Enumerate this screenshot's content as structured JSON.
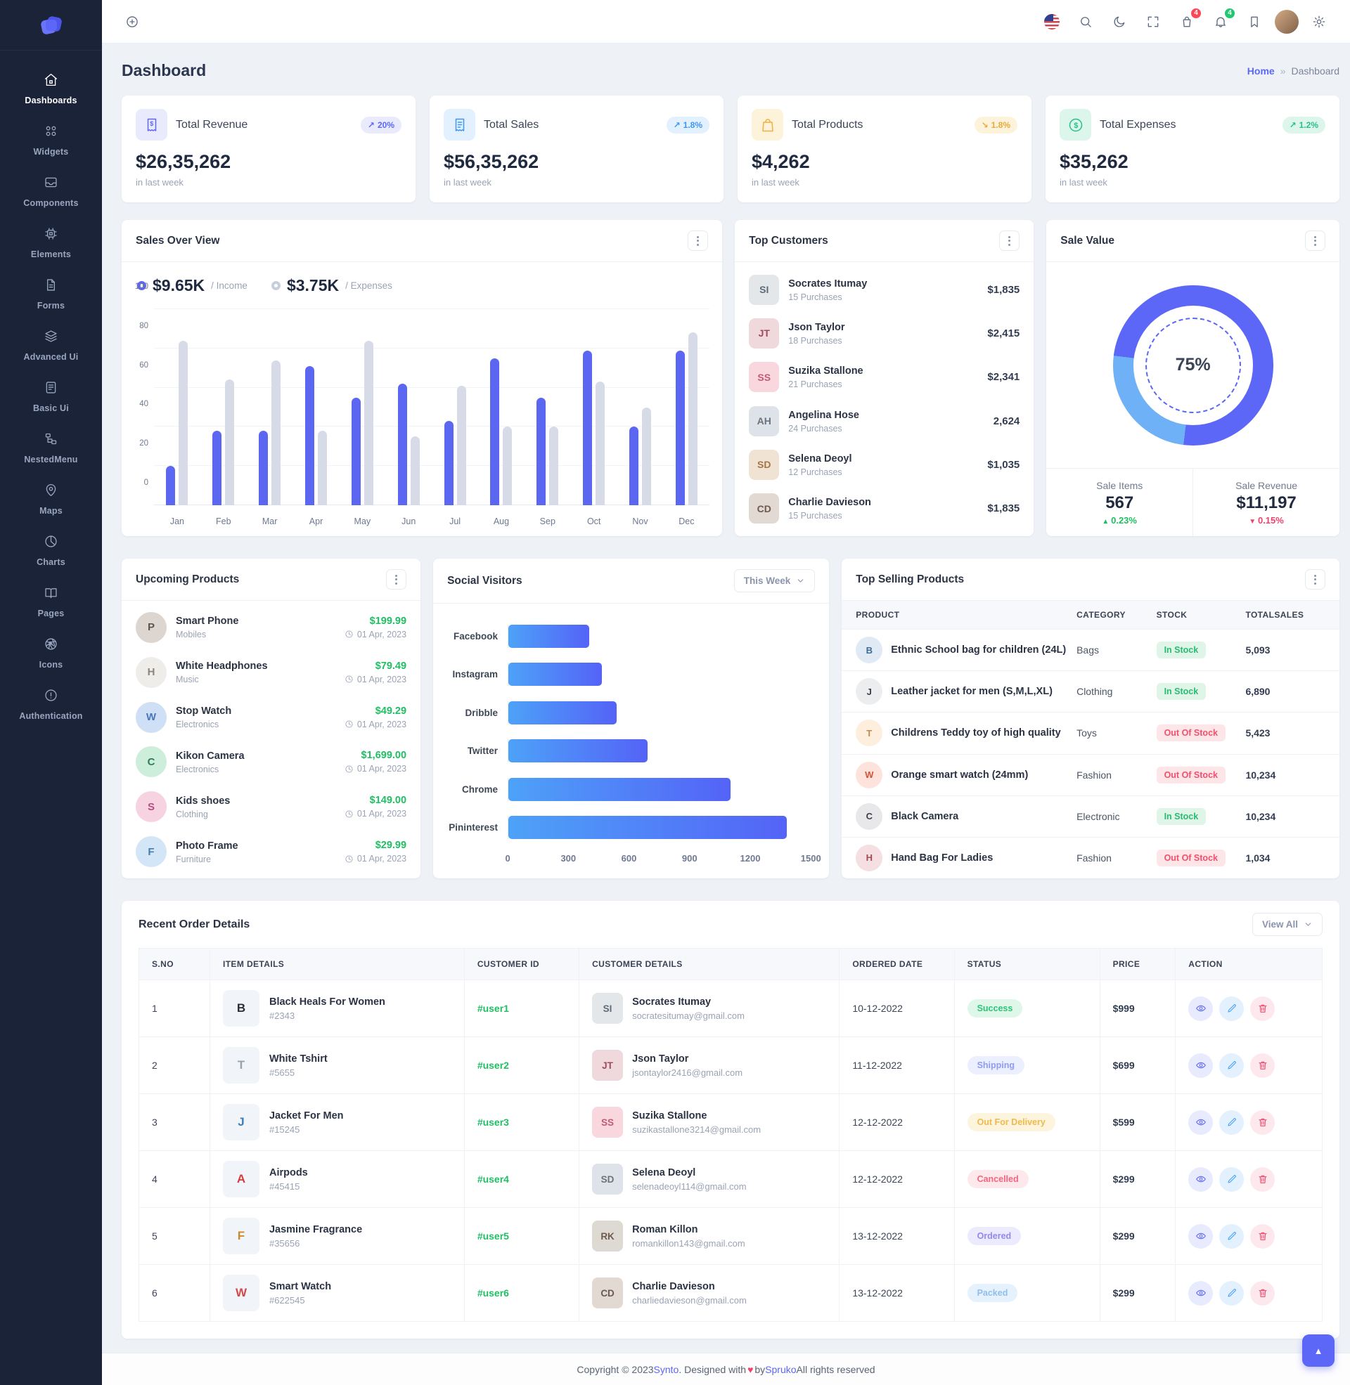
{
  "app": {
    "name": "Synto"
  },
  "header": {
    "cart_badge": "4",
    "notification_badge": "4",
    "icons": [
      "plus-circle-icon",
      "us-flag-icon",
      "search-icon",
      "moon-icon",
      "fullscreen-icon",
      "basket-icon",
      "bell-icon",
      "bookmark-icon",
      "user-avatar",
      "gear-icon"
    ]
  },
  "sidebar": {
    "items": [
      {
        "label": "Dashboards",
        "icon": "home-icon"
      },
      {
        "label": "Widgets",
        "icon": "grid-icon"
      },
      {
        "label": "Components",
        "icon": "inbox-icon"
      },
      {
        "label": "Elements",
        "icon": "cpu-icon"
      },
      {
        "label": "Forms",
        "icon": "file-icon"
      },
      {
        "label": "Advanced Ui",
        "icon": "layers-icon"
      },
      {
        "label": "Basic Ui",
        "icon": "journal-icon"
      },
      {
        "label": "NestedMenu",
        "icon": "tree-icon"
      },
      {
        "label": "Maps",
        "icon": "pin-icon"
      },
      {
        "label": "Charts",
        "icon": "pie-icon"
      },
      {
        "label": "Pages",
        "icon": "book-icon"
      },
      {
        "label": "Icons",
        "icon": "aperture-icon"
      },
      {
        "label": "Authentication",
        "icon": "alert-icon"
      }
    ]
  },
  "page": {
    "title": "Dashboard",
    "breadcrumb": {
      "home": "Home",
      "separator": "»",
      "current": "Dashboard"
    }
  },
  "stats": [
    {
      "label": "Total Revenue",
      "value": "$26,35,262",
      "caption": "in last week",
      "badge": "20%",
      "trend": "up"
    },
    {
      "label": "Total Sales",
      "value": "$56,35,262",
      "caption": "in last week",
      "badge": "1.8%",
      "trend": "up"
    },
    {
      "label": "Total Products",
      "value": "$4,262",
      "caption": "in last week",
      "badge": "1.8%",
      "trend": "down"
    },
    {
      "label": "Total Expenses",
      "value": "$35,262",
      "caption": "in last week",
      "badge": "1.2%",
      "trend": "up"
    }
  ],
  "sales_overview": {
    "title": "Sales Over View",
    "income_value": "$9.65K",
    "income_label": "/ Income",
    "expenses_value": "$3.75K",
    "expenses_label": "/ Expenses"
  },
  "top_customers": {
    "title": "Top Customers",
    "items": [
      {
        "name": "Socrates Itumay",
        "purchases": "15 Purchases",
        "amount": "$1,835",
        "initials": "SI"
      },
      {
        "name": "Json Taylor",
        "purchases": "18 Purchases",
        "amount": "$2,415",
        "initials": "JT"
      },
      {
        "name": "Suzika Stallone",
        "purchases": "21 Purchases",
        "amount": "$2,341",
        "initials": "SS"
      },
      {
        "name": "Angelina Hose",
        "purchases": "24 Purchases",
        "amount": "2,624",
        "initials": "AH"
      },
      {
        "name": "Selena Deoyl",
        "purchases": "12 Purchases",
        "amount": "$1,035",
        "initials": "SD"
      },
      {
        "name": "Charlie Davieson",
        "purchases": "15 Purchases",
        "amount": "$1,835",
        "initials": "CD"
      }
    ]
  },
  "sale_value": {
    "title": "Sale Value",
    "percent": "75%",
    "items_label": "Sale Items",
    "items_value": "567",
    "items_delta": "0.23%",
    "revenue_label": "Sale Revenue",
    "revenue_value": "$11,197",
    "revenue_delta": "0.15%"
  },
  "upcoming_products": {
    "title": "Upcoming Products",
    "items": [
      {
        "name": "Smart Phone",
        "category": "Mobiles",
        "price": "$199.99",
        "date": "01 Apr, 2023",
        "initial": "P"
      },
      {
        "name": "White Headphones",
        "category": "Music",
        "price": "$79.49",
        "date": "01 Apr, 2023",
        "initial": "H"
      },
      {
        "name": "Stop Watch",
        "category": "Electronics",
        "price": "$49.29",
        "date": "01 Apr, 2023",
        "initial": "W"
      },
      {
        "name": "Kikon Camera",
        "category": "Electronics",
        "price": "$1,699.00",
        "date": "01 Apr, 2023",
        "initial": "C"
      },
      {
        "name": "Kids shoes",
        "category": "Clothing",
        "price": "$149.00",
        "date": "01 Apr, 2023",
        "initial": "S"
      },
      {
        "name": "Photo Frame",
        "category": "Furniture",
        "price": "$29.99",
        "date": "01 Apr, 2023",
        "initial": "F"
      }
    ]
  },
  "social_visitors": {
    "title": "Social Visitors",
    "filter": "This Week"
  },
  "top_selling": {
    "title": "Top Selling Products",
    "headers": [
      "PRODUCT",
      "CATEGORY",
      "STOCK",
      "TOTALSALES"
    ],
    "rows": [
      {
        "product": "Ethnic School bag for children (24L)",
        "category": "Bags",
        "stock": "In Stock",
        "total": "5,093",
        "initial": "B"
      },
      {
        "product": "Leather jacket for men (S,M,L,XL)",
        "category": "Clothing",
        "stock": "In Stock",
        "total": "6,890",
        "initial": "J"
      },
      {
        "product": "Childrens Teddy toy of high quality",
        "category": "Toys",
        "stock": "Out Of Stock",
        "total": "5,423",
        "initial": "T"
      },
      {
        "product": "Orange smart watch (24mm)",
        "category": "Fashion",
        "stock": "Out Of Stock",
        "total": "10,234",
        "initial": "W"
      },
      {
        "product": "Black Camera",
        "category": "Electronic",
        "stock": "In Stock",
        "total": "10,234",
        "initial": "C"
      },
      {
        "product": "Hand Bag For Ladies",
        "category": "Fashion",
        "stock": "Out Of Stock",
        "total": "1,034",
        "initial": "H"
      }
    ]
  },
  "recent_orders": {
    "title": "Recent Order Details",
    "view_all": "View All",
    "headers": [
      "S.NO",
      "ITEM DETAILS",
      "CUSTOMER ID",
      "CUSTOMER DETAILS",
      "ORDERED DATE",
      "STATUS",
      "PRICE",
      "ACTION"
    ],
    "rows": [
      {
        "sno": "1",
        "item": "Black Heals For Women",
        "item_id": "#2343",
        "customer_id": "#user1",
        "customer": "Socrates Itumay",
        "email": "socratesitumay@gmail.com",
        "date": "10-12-2022",
        "status": "Success",
        "price": "$999",
        "item_initial": "B",
        "cust_initials": "SI"
      },
      {
        "sno": "2",
        "item": "White Tshirt",
        "item_id": "#5655",
        "customer_id": "#user2",
        "customer": "Json Taylor",
        "email": "jsontaylor2416@gmail.com",
        "date": "11-12-2022",
        "status": "Shipping",
        "price": "$699",
        "item_initial": "T",
        "cust_initials": "JT"
      },
      {
        "sno": "3",
        "item": "Jacket For Men",
        "item_id": "#15245",
        "customer_id": "#user3",
        "customer": "Suzika Stallone",
        "email": "suzikastallone3214@gmail.com",
        "date": "12-12-2022",
        "status": "Out For Delivery",
        "price": "$599",
        "item_initial": "J",
        "cust_initials": "SS"
      },
      {
        "sno": "4",
        "item": "Airpods",
        "item_id": "#45415",
        "customer_id": "#user4",
        "customer": "Selena Deoyl",
        "email": "selenadeoyl114@gmail.com",
        "date": "12-12-2022",
        "status": "Cancelled",
        "price": "$299",
        "item_initial": "A",
        "cust_initials": "SD"
      },
      {
        "sno": "5",
        "item": "Jasmine Fragrance",
        "item_id": "#35656",
        "customer_id": "#user5",
        "customer": "Roman Killon",
        "email": "romankillon143@gmail.com",
        "date": "13-12-2022",
        "status": "Ordered",
        "price": "$299",
        "item_initial": "F",
        "cust_initials": "RK"
      },
      {
        "sno": "6",
        "item": "Smart Watch",
        "item_id": "#622545",
        "customer_id": "#user6",
        "customer": "Charlie Davieson",
        "email": "charliedavieson@gmail.com",
        "date": "13-12-2022",
        "status": "Packed",
        "price": "$299",
        "item_initial": "W",
        "cust_initials": "CD"
      }
    ]
  },
  "footer": {
    "pre": "Copyright © 2023 ",
    "brand": "Synto",
    "mid": ". Designed with ",
    "heart": "♥",
    "by": " by ",
    "brand2": "Spruko",
    "post": " All rights reserved"
  },
  "chart_data": [
    {
      "type": "bar",
      "title": "Sales Over View",
      "categories": [
        "Jan",
        "Feb",
        "Mar",
        "Apr",
        "May",
        "Jun",
        "Jul",
        "Aug",
        "Sep",
        "Oct",
        "Nov",
        "Dec"
      ],
      "series": [
        {
          "name": "Income",
          "values": [
            20,
            38,
            38,
            71,
            55,
            62,
            43,
            75,
            55,
            79,
            40,
            79
          ],
          "color": "#5b67f1"
        },
        {
          "name": "Expenses",
          "values": [
            84,
            64,
            74,
            38,
            84,
            35,
            61,
            40,
            40,
            63,
            50,
            88
          ],
          "color": "#d6dbe7"
        }
      ],
      "ylim": [
        0,
        100
      ],
      "ytick_step": 20,
      "grid": true,
      "legend_position": "top"
    },
    {
      "type": "bar",
      "orientation": "horizontal",
      "title": "Social Visitors",
      "categories": [
        "Facebook",
        "Instagram",
        "Dribble",
        "Twitter",
        "Chrome",
        "Pininterest"
      ],
      "values": [
        400,
        465,
        535,
        690,
        1100,
        1380
      ],
      "xlim": [
        0,
        1500
      ],
      "xticks": [
        0,
        300,
        600,
        900,
        1200,
        1500
      ],
      "bar_color_gradient": [
        "#4da2f8",
        "#5463f7"
      ]
    },
    {
      "type": "pie",
      "title": "Sale Value",
      "values": [
        75,
        25
      ],
      "colors": [
        "#5c67f7",
        "#6fb1f6"
      ],
      "center_label": "75%"
    }
  ]
}
